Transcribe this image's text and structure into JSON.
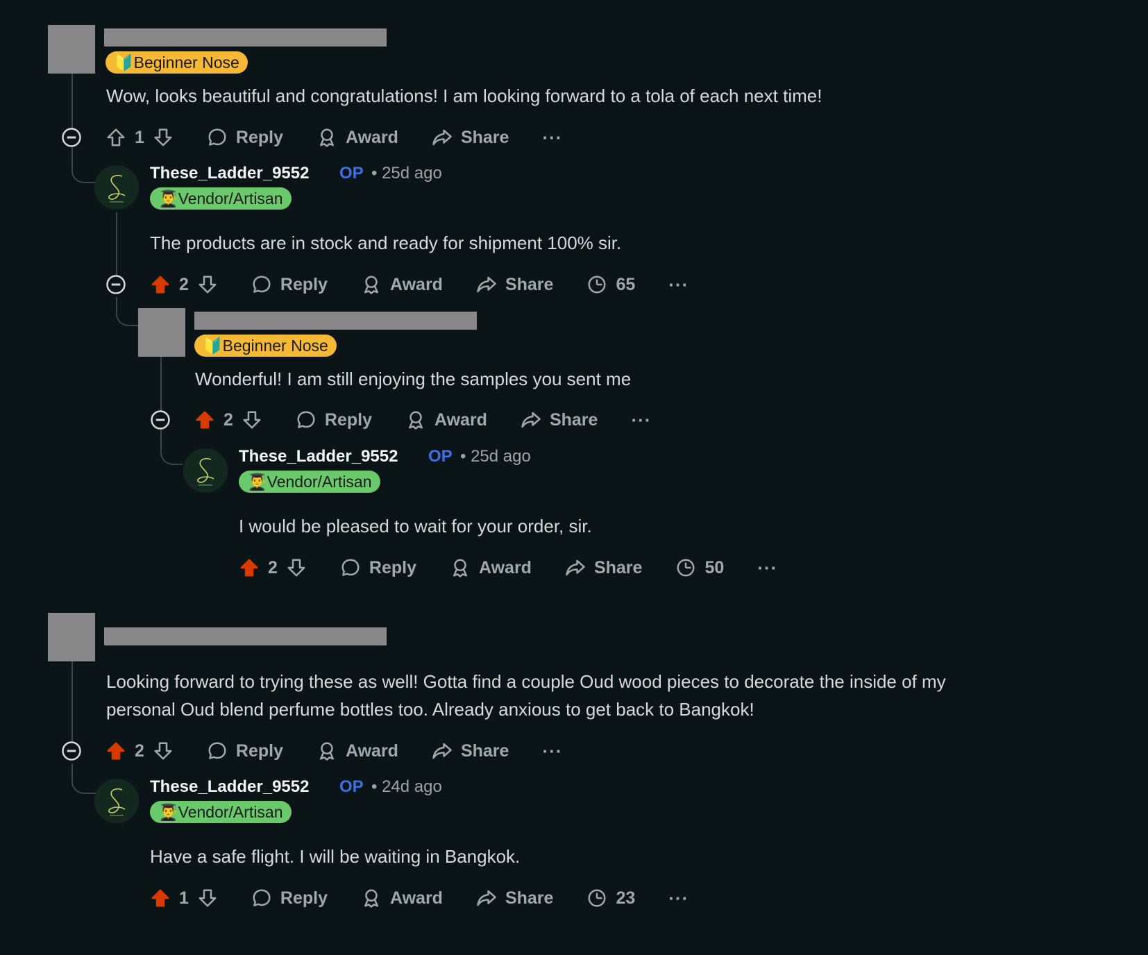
{
  "colors": {
    "background": "#0b1416",
    "upvoted": "#d93a00",
    "op": "#3d6fe6",
    "flair_yellow": "#f5b935",
    "flair_green": "#6ac96a"
  },
  "actions": {
    "reply": "Reply",
    "award": "Award",
    "share": "Share",
    "more": "···"
  },
  "comments": [
    {
      "flair": "🔰Beginner Nose",
      "body": "Wow, looks beautiful and congratulations! I am looking forward to a tola of each next time!",
      "votes": "1",
      "upvoted": false
    },
    {
      "username": "These_Ladder_9552",
      "op": "OP",
      "time": "• 25d ago",
      "flair": "👨‍🎓Vendor/Artisan",
      "body": "The products are in stock and ready for shipment 100% sir.",
      "votes": "2",
      "upvoted": true,
      "views": "65"
    },
    {
      "flair": "🔰Beginner Nose",
      "body": "Wonderful! I am still enjoying the samples you sent me",
      "votes": "2",
      "upvoted": true
    },
    {
      "username": "These_Ladder_9552",
      "op": "OP",
      "time": "• 25d ago",
      "flair": "👨‍🎓Vendor/Artisan",
      "body": "I would be pleased to wait for your order, sir.",
      "votes": "2",
      "upvoted": true,
      "views": "50"
    },
    {
      "body_lines": [
        "Looking forward to trying these as well! Gotta find a couple Oud wood pieces to decorate the inside of my",
        "personal Oud blend perfume bottles too. Already anxious to get back to Bangkok!"
      ],
      "votes": "2",
      "upvoted": true
    },
    {
      "username": "These_Ladder_9552",
      "op": "OP",
      "time": "• 24d ago",
      "flair": "👨‍🎓Vendor/Artisan",
      "body": "Have a safe flight. I will be waiting in Bangkok.",
      "votes": "1",
      "upvoted": true,
      "views": "23"
    }
  ]
}
